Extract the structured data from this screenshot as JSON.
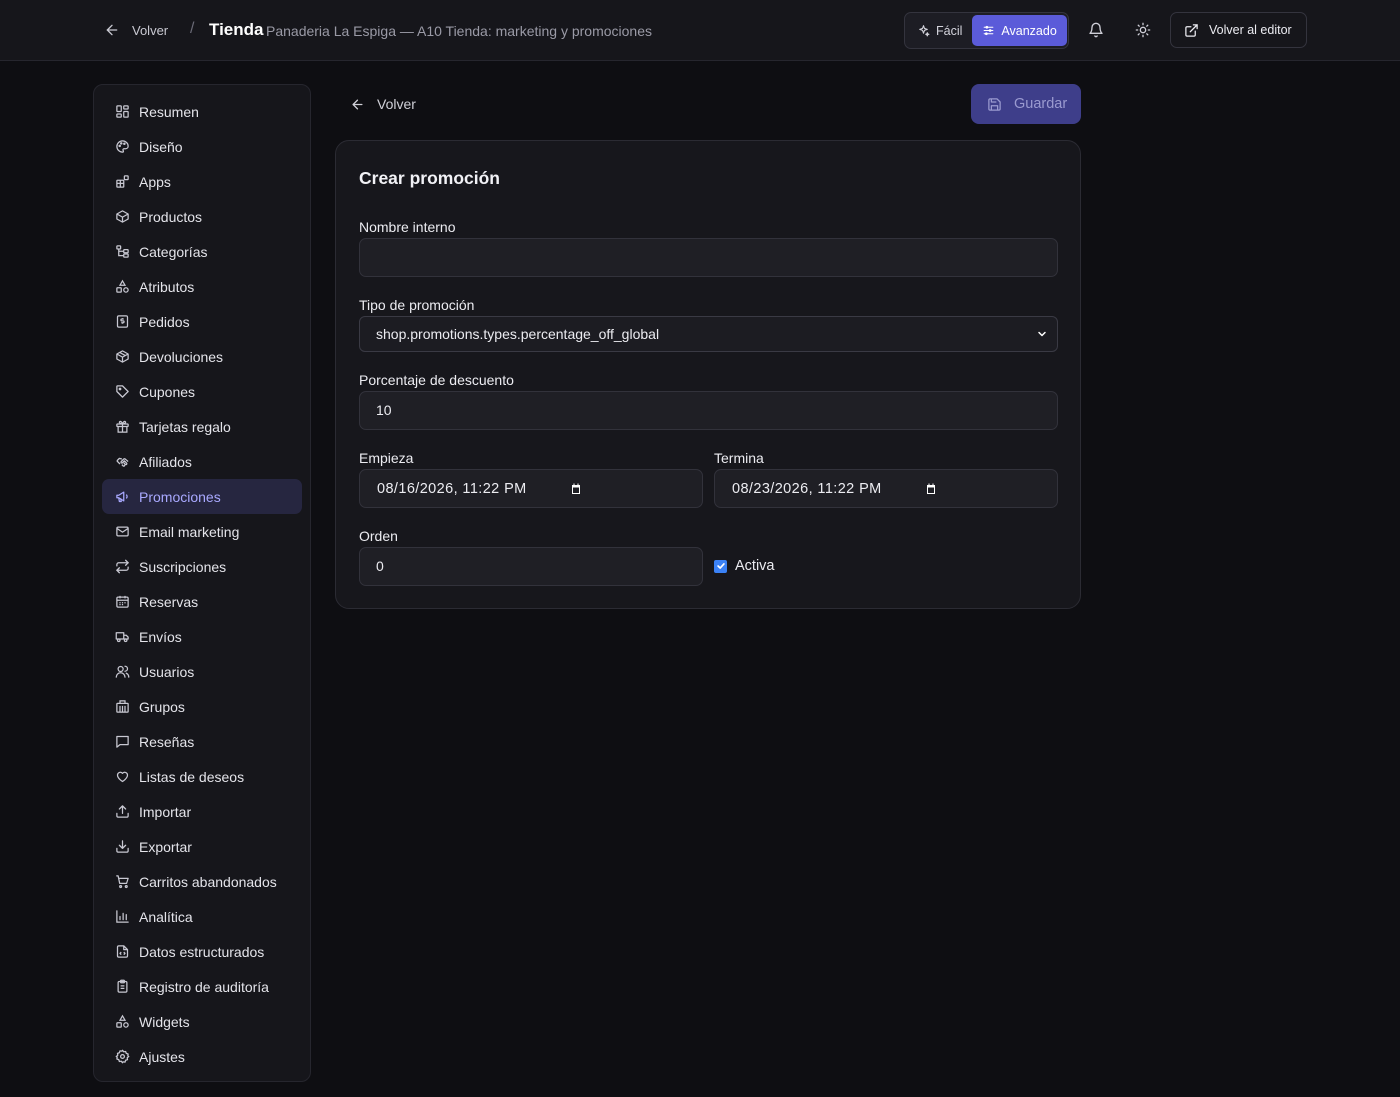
{
  "topbar": {
    "back_label": "Volver",
    "separator": "/",
    "title": "Tienda",
    "subtitle": "Panaderia La Espiga — A10 Tienda: marketing y promociones",
    "modes": [
      {
        "label": "Fácil",
        "icon": "sparkles-icon",
        "active": false
      },
      {
        "label": "Avanzado",
        "icon": "sliders-icon",
        "active": true
      }
    ],
    "editor_label": "Volver al editor"
  },
  "sidebar": {
    "items": [
      {
        "label": "Resumen",
        "icon": "grid-icon"
      },
      {
        "label": "Diseño",
        "icon": "palette-icon"
      },
      {
        "label": "Apps",
        "icon": "apps-icon"
      },
      {
        "label": "Productos",
        "icon": "box-icon"
      },
      {
        "label": "Categorías",
        "icon": "tree-icon"
      },
      {
        "label": "Atributos",
        "icon": "shapes-icon"
      },
      {
        "label": "Pedidos",
        "icon": "receipt-icon"
      },
      {
        "label": "Devoluciones",
        "icon": "box-return-icon"
      },
      {
        "label": "Cupones",
        "icon": "tag-icon"
      },
      {
        "label": "Tarjetas regalo",
        "icon": "gift-icon"
      },
      {
        "label": "Afiliados",
        "icon": "handshake-icon"
      },
      {
        "label": "Promociones",
        "icon": "megaphone-icon",
        "active": true
      },
      {
        "label": "Email marketing",
        "icon": "mail-icon"
      },
      {
        "label": "Suscripciones",
        "icon": "repeat-icon"
      },
      {
        "label": "Reservas",
        "icon": "calendar-icon"
      },
      {
        "label": "Envíos",
        "icon": "truck-icon"
      },
      {
        "label": "Usuarios",
        "icon": "users-icon"
      },
      {
        "label": "Grupos",
        "icon": "building-icon"
      },
      {
        "label": "Reseñas",
        "icon": "message-icon"
      },
      {
        "label": "Listas de deseos",
        "icon": "heart-icon"
      },
      {
        "label": "Importar",
        "icon": "upload-icon"
      },
      {
        "label": "Exportar",
        "icon": "download-icon"
      },
      {
        "label": "Carritos abandonados",
        "icon": "cart-icon"
      },
      {
        "label": "Analítica",
        "icon": "bar-chart-icon"
      },
      {
        "label": "Datos estructurados",
        "icon": "file-code-icon"
      },
      {
        "label": "Registro de auditoría",
        "icon": "clipboard-icon"
      },
      {
        "label": "Widgets",
        "icon": "shapes-icon"
      },
      {
        "label": "Ajustes",
        "icon": "gear-icon"
      }
    ]
  },
  "main": {
    "back_label": "Volver",
    "save_label": "Guardar",
    "card_title": "Crear promoción",
    "fields": {
      "internal_name": {
        "label": "Nombre interno",
        "value": ""
      },
      "promo_type": {
        "label": "Tipo de promoción",
        "value": "shop.promotions.types.percentage_off_global"
      },
      "discount_pct": {
        "label": "Porcentaje de descuento",
        "value": "10"
      },
      "starts": {
        "label": "Empieza",
        "value": "08/16/2026, 11:22 PM"
      },
      "ends": {
        "label": "Termina",
        "value": "08/23/2026, 11:22 PM"
      },
      "order": {
        "label": "Orden",
        "value": "0"
      },
      "active": {
        "label": "Activa",
        "checked": true
      }
    }
  },
  "colors": {
    "accent": "#5b5bd9",
    "active_nav_bg": "#262640",
    "active_nav_text": "#a9a9ff",
    "background": "#0e0e12",
    "panel": "#16161b",
    "checkbox": "#3b82f6"
  }
}
